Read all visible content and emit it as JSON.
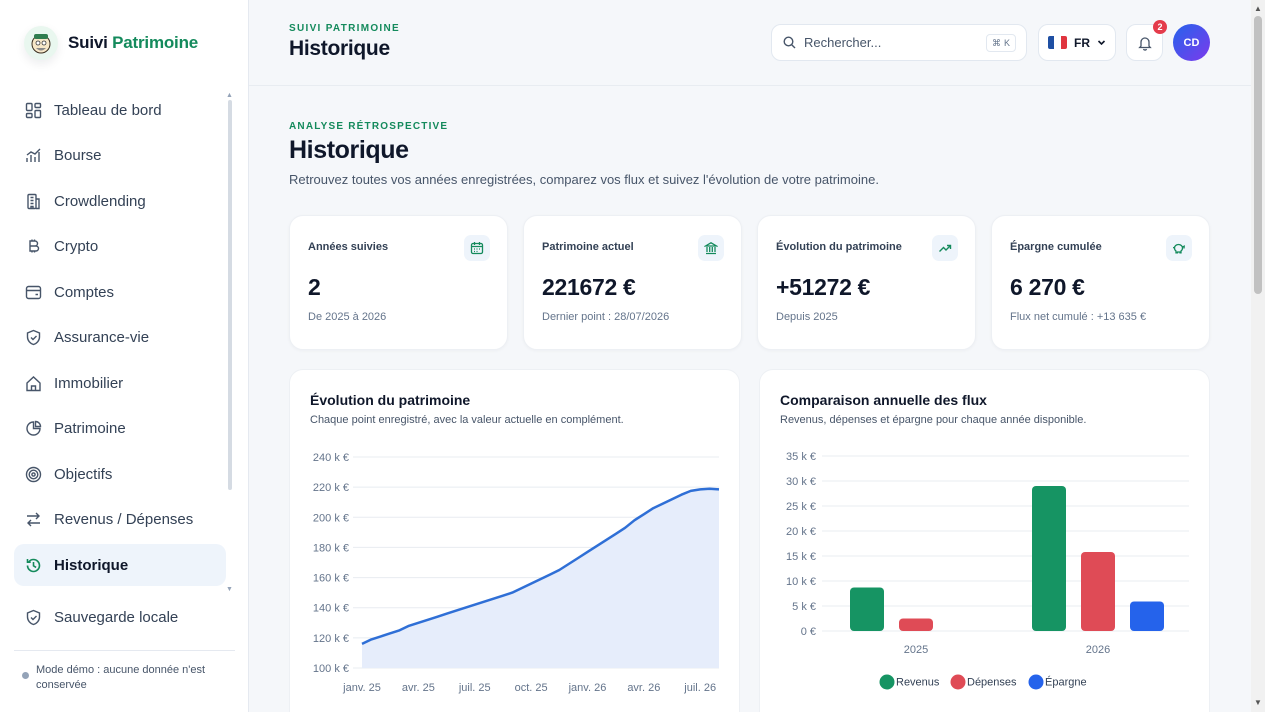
{
  "brand": {
    "name_part1": "Suivi",
    "name_part2": "Patrimoine"
  },
  "sidebar": {
    "items": [
      {
        "label": "Tableau de bord",
        "icon": "dashboard-icon"
      },
      {
        "label": "Bourse",
        "icon": "stock-chart-icon"
      },
      {
        "label": "Crowdlending",
        "icon": "building-icon"
      },
      {
        "label": "Crypto",
        "icon": "bitcoin-icon"
      },
      {
        "label": "Comptes",
        "icon": "wallet-icon"
      },
      {
        "label": "Assurance-vie",
        "icon": "shield-icon"
      },
      {
        "label": "Immobilier",
        "icon": "home-icon"
      },
      {
        "label": "Patrimoine",
        "icon": "pie-icon"
      },
      {
        "label": "Objectifs",
        "icon": "target-icon"
      },
      {
        "label": "Revenus / Dépenses",
        "icon": "swap-icon"
      },
      {
        "label": "Historique",
        "icon": "history-icon",
        "active": true
      }
    ],
    "backup": {
      "label": "Sauvegarde locale",
      "icon": "shield-check-icon"
    },
    "demo_note": "Mode démo : aucune donnée n'est conservée"
  },
  "header": {
    "kicker": "SUIVI PATRIMOINE",
    "title": "Historique",
    "search_placeholder": "Rechercher...",
    "search_shortcut": "K",
    "language": "FR",
    "notifications_count": "2",
    "avatar_initials": "CD"
  },
  "main": {
    "kicker": "ANALYSE RÉTROSPECTIVE",
    "title": "Historique",
    "subtitle": "Retrouvez toutes vos années enregistrées, comparez vos flux et suivez l'évolution de votre patrimoine."
  },
  "stats": [
    {
      "label": "Années suivies",
      "value": "2",
      "sub": "De 2025 à 2026",
      "icon": "calendar-icon"
    },
    {
      "label": "Patrimoine actuel",
      "value": "221672 €",
      "sub": "Dernier point : 28/07/2026",
      "icon": "bank-icon"
    },
    {
      "label": "Évolution du patrimoine",
      "value": "+51272 €",
      "sub": "Depuis 2025",
      "icon": "trending-up-icon"
    },
    {
      "label": "Épargne cumulée",
      "value": "6 270 €",
      "sub": "Flux net cumulé : +13 635 €",
      "icon": "piggy-bank-icon"
    }
  ],
  "colors": {
    "accent": "#148a5c",
    "line": "#2f6fd6",
    "revenus": "#169463",
    "depenses": "#df4b56",
    "epargne": "#2563eb"
  },
  "chart_data": [
    {
      "type": "area",
      "title": "Évolution du patrimoine",
      "subtitle": "Chaque point enregistré, avec la valeur actuelle en complément.",
      "xlabel": "",
      "ylabel": "",
      "x_ticks": [
        "janv. 25",
        "avr. 25",
        "juil. 25",
        "oct. 25",
        "janv. 26",
        "avr. 26",
        "juil. 26"
      ],
      "y_ticks": [
        "100 k €",
        "120 k €",
        "140 k €",
        "160 k €",
        "180 k €",
        "200 k €",
        "220 k €",
        "240 k €"
      ],
      "ylim": [
        100,
        240
      ],
      "x_months": [
        0,
        0.5,
        1,
        1.5,
        2,
        2.5,
        3,
        3.5,
        4,
        4.5,
        5,
        5.5,
        6,
        6.5,
        7,
        7.5,
        8,
        8.5,
        9,
        9.5,
        10,
        10.5,
        11,
        11.5,
        12,
        12.5,
        13,
        13.5,
        14,
        14.5,
        15,
        15.5,
        16,
        16.5,
        17,
        17.5,
        18,
        18.5,
        19
      ],
      "values": [
        116,
        119,
        121,
        123,
        125,
        128,
        130,
        132,
        134,
        136,
        138,
        140,
        142,
        144,
        146,
        148,
        150,
        153,
        156,
        159,
        162,
        165,
        169,
        173,
        177,
        181,
        185,
        189,
        193,
        198,
        202,
        206,
        209,
        212,
        215,
        217.5,
        218.5,
        219,
        218.5
      ],
      "grid": true
    },
    {
      "type": "bar",
      "title": "Comparaison annuelle des flux",
      "subtitle": "Revenus, dépenses et épargne pour chaque année disponible.",
      "categories": [
        "2025",
        "2026"
      ],
      "series": [
        {
          "name": "Revenus",
          "values": [
            8.7,
            29
          ]
        },
        {
          "name": "Dépenses",
          "values": [
            2.5,
            15.8
          ]
        },
        {
          "name": "Épargne",
          "values": [
            0,
            5.9
          ]
        }
      ],
      "y_ticks": [
        "0 €",
        "5 k €",
        "10 k €",
        "15 k €",
        "20 k €",
        "25 k €",
        "30 k €",
        "35 k €"
      ],
      "ylim": [
        0,
        35
      ],
      "legend": "bottom",
      "grid": true
    }
  ]
}
